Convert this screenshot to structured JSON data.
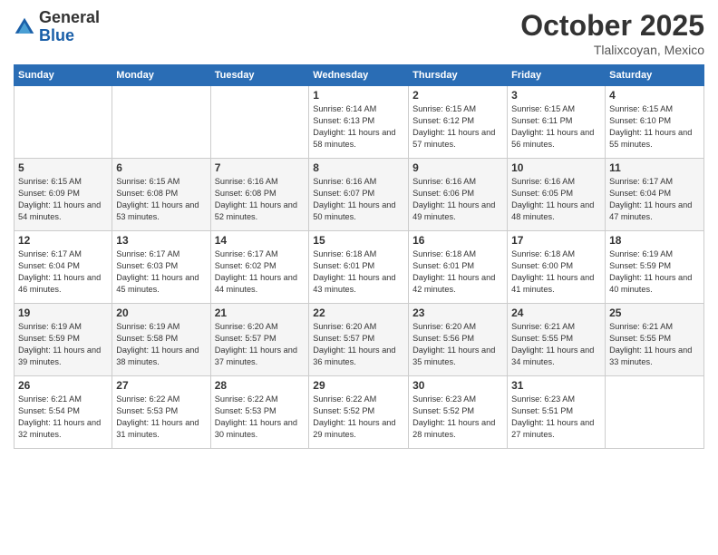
{
  "header": {
    "logo_general": "General",
    "logo_blue": "Blue",
    "month": "October 2025",
    "location": "Tlalixcoyan, Mexico"
  },
  "weekdays": [
    "Sunday",
    "Monday",
    "Tuesday",
    "Wednesday",
    "Thursday",
    "Friday",
    "Saturday"
  ],
  "weeks": [
    [
      {
        "day": "",
        "info": ""
      },
      {
        "day": "",
        "info": ""
      },
      {
        "day": "",
        "info": ""
      },
      {
        "day": "1",
        "info": "Sunrise: 6:14 AM\nSunset: 6:13 PM\nDaylight: 11 hours\nand 58 minutes."
      },
      {
        "day": "2",
        "info": "Sunrise: 6:15 AM\nSunset: 6:12 PM\nDaylight: 11 hours\nand 57 minutes."
      },
      {
        "day": "3",
        "info": "Sunrise: 6:15 AM\nSunset: 6:11 PM\nDaylight: 11 hours\nand 56 minutes."
      },
      {
        "day": "4",
        "info": "Sunrise: 6:15 AM\nSunset: 6:10 PM\nDaylight: 11 hours\nand 55 minutes."
      }
    ],
    [
      {
        "day": "5",
        "info": "Sunrise: 6:15 AM\nSunset: 6:09 PM\nDaylight: 11 hours\nand 54 minutes."
      },
      {
        "day": "6",
        "info": "Sunrise: 6:15 AM\nSunset: 6:08 PM\nDaylight: 11 hours\nand 53 minutes."
      },
      {
        "day": "7",
        "info": "Sunrise: 6:16 AM\nSunset: 6:08 PM\nDaylight: 11 hours\nand 52 minutes."
      },
      {
        "day": "8",
        "info": "Sunrise: 6:16 AM\nSunset: 6:07 PM\nDaylight: 11 hours\nand 50 minutes."
      },
      {
        "day": "9",
        "info": "Sunrise: 6:16 AM\nSunset: 6:06 PM\nDaylight: 11 hours\nand 49 minutes."
      },
      {
        "day": "10",
        "info": "Sunrise: 6:16 AM\nSunset: 6:05 PM\nDaylight: 11 hours\nand 48 minutes."
      },
      {
        "day": "11",
        "info": "Sunrise: 6:17 AM\nSunset: 6:04 PM\nDaylight: 11 hours\nand 47 minutes."
      }
    ],
    [
      {
        "day": "12",
        "info": "Sunrise: 6:17 AM\nSunset: 6:04 PM\nDaylight: 11 hours\nand 46 minutes."
      },
      {
        "day": "13",
        "info": "Sunrise: 6:17 AM\nSunset: 6:03 PM\nDaylight: 11 hours\nand 45 minutes."
      },
      {
        "day": "14",
        "info": "Sunrise: 6:17 AM\nSunset: 6:02 PM\nDaylight: 11 hours\nand 44 minutes."
      },
      {
        "day": "15",
        "info": "Sunrise: 6:18 AM\nSunset: 6:01 PM\nDaylight: 11 hours\nand 43 minutes."
      },
      {
        "day": "16",
        "info": "Sunrise: 6:18 AM\nSunset: 6:01 PM\nDaylight: 11 hours\nand 42 minutes."
      },
      {
        "day": "17",
        "info": "Sunrise: 6:18 AM\nSunset: 6:00 PM\nDaylight: 11 hours\nand 41 minutes."
      },
      {
        "day": "18",
        "info": "Sunrise: 6:19 AM\nSunset: 5:59 PM\nDaylight: 11 hours\nand 40 minutes."
      }
    ],
    [
      {
        "day": "19",
        "info": "Sunrise: 6:19 AM\nSunset: 5:59 PM\nDaylight: 11 hours\nand 39 minutes."
      },
      {
        "day": "20",
        "info": "Sunrise: 6:19 AM\nSunset: 5:58 PM\nDaylight: 11 hours\nand 38 minutes."
      },
      {
        "day": "21",
        "info": "Sunrise: 6:20 AM\nSunset: 5:57 PM\nDaylight: 11 hours\nand 37 minutes."
      },
      {
        "day": "22",
        "info": "Sunrise: 6:20 AM\nSunset: 5:57 PM\nDaylight: 11 hours\nand 36 minutes."
      },
      {
        "day": "23",
        "info": "Sunrise: 6:20 AM\nSunset: 5:56 PM\nDaylight: 11 hours\nand 35 minutes."
      },
      {
        "day": "24",
        "info": "Sunrise: 6:21 AM\nSunset: 5:55 PM\nDaylight: 11 hours\nand 34 minutes."
      },
      {
        "day": "25",
        "info": "Sunrise: 6:21 AM\nSunset: 5:55 PM\nDaylight: 11 hours\nand 33 minutes."
      }
    ],
    [
      {
        "day": "26",
        "info": "Sunrise: 6:21 AM\nSunset: 5:54 PM\nDaylight: 11 hours\nand 32 minutes."
      },
      {
        "day": "27",
        "info": "Sunrise: 6:22 AM\nSunset: 5:53 PM\nDaylight: 11 hours\nand 31 minutes."
      },
      {
        "day": "28",
        "info": "Sunrise: 6:22 AM\nSunset: 5:53 PM\nDaylight: 11 hours\nand 30 minutes."
      },
      {
        "day": "29",
        "info": "Sunrise: 6:22 AM\nSunset: 5:52 PM\nDaylight: 11 hours\nand 29 minutes."
      },
      {
        "day": "30",
        "info": "Sunrise: 6:23 AM\nSunset: 5:52 PM\nDaylight: 11 hours\nand 28 minutes."
      },
      {
        "day": "31",
        "info": "Sunrise: 6:23 AM\nSunset: 5:51 PM\nDaylight: 11 hours\nand 27 minutes."
      },
      {
        "day": "",
        "info": ""
      }
    ]
  ]
}
